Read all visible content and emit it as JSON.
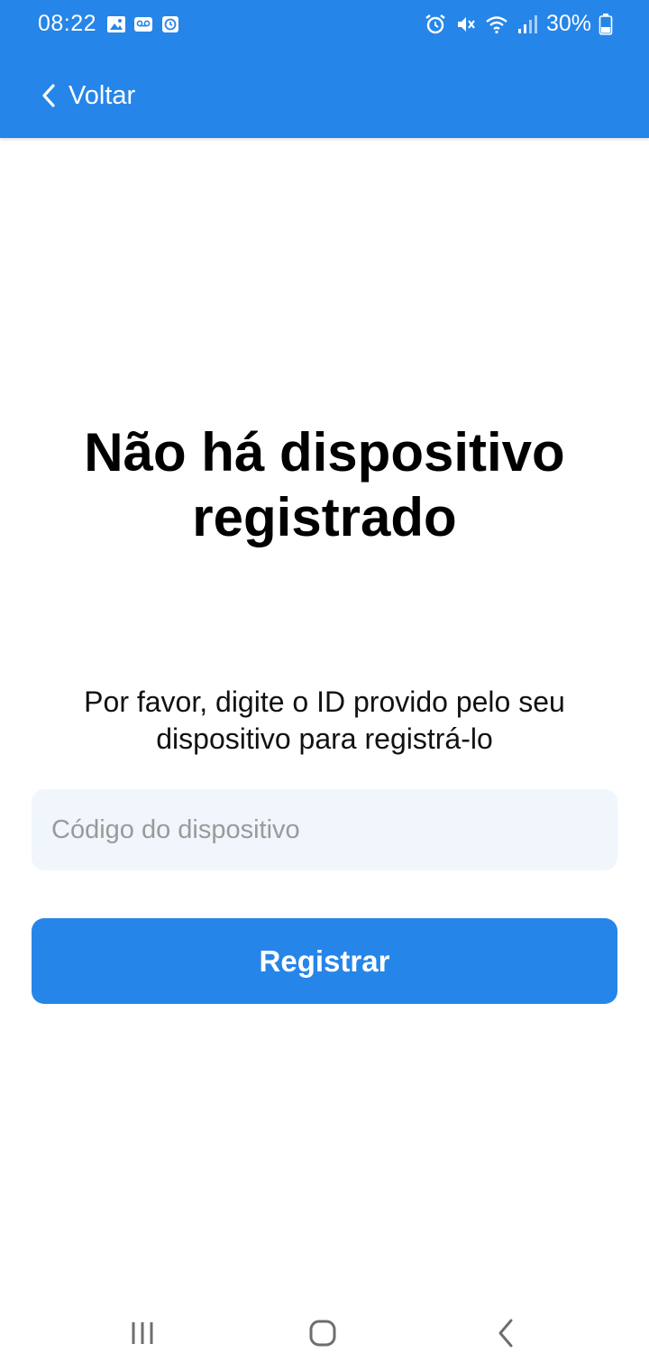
{
  "status_bar": {
    "time": "08:22",
    "battery_percent": "30%",
    "left_icons": [
      "gallery-icon",
      "voicemail-icon",
      "clock-app-icon"
    ],
    "right_icons": [
      "alarm-icon",
      "mute-icon",
      "wifi-icon",
      "signal-icon",
      "battery-icon"
    ]
  },
  "header": {
    "back_label": "Voltar",
    "color": "#2685e8"
  },
  "main": {
    "title": "Não há dispositivo registrado",
    "instruction": "Por favor, digite o ID provido pelo seu dispositivo para registrá-lo",
    "input": {
      "placeholder": "Código do dispositivo",
      "value": ""
    },
    "register_label": "Registrar"
  },
  "nav_bar": {
    "buttons": [
      "recents-icon",
      "home-icon",
      "back-icon"
    ]
  }
}
